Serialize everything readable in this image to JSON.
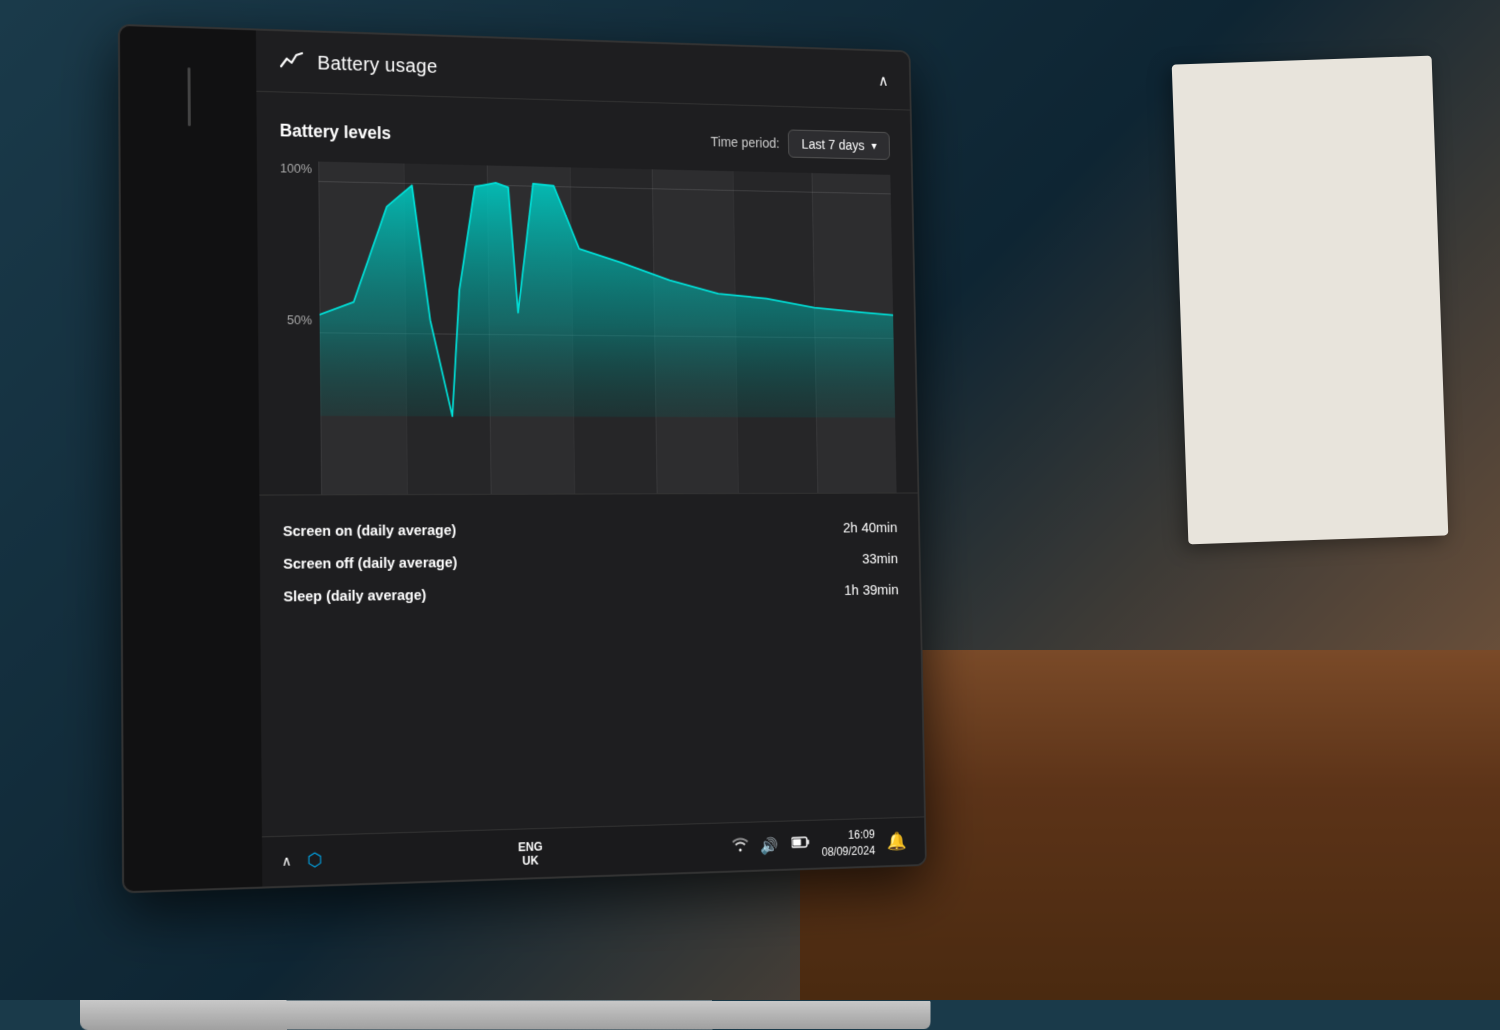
{
  "header": {
    "title": "Battery usage",
    "icon": "📈",
    "chevron": "∧"
  },
  "battery_levels": {
    "section_title": "Battery levels",
    "time_period_label": "Time period:",
    "time_period_value": "Last 7 days",
    "y_axis": {
      "top": "100%",
      "middle": "50%"
    }
  },
  "stats": [
    {
      "label": "Screen on (daily average)",
      "value": "2h 40min"
    },
    {
      "label": "Screen off (daily average)",
      "value": "33min"
    },
    {
      "label": "Sleep (daily average)",
      "value": "1h 39min"
    }
  ],
  "taskbar": {
    "chevron": "∧",
    "lang_top": "ENG",
    "lang_bottom": "UK",
    "time": "16:09",
    "date": "08/09/2024"
  }
}
